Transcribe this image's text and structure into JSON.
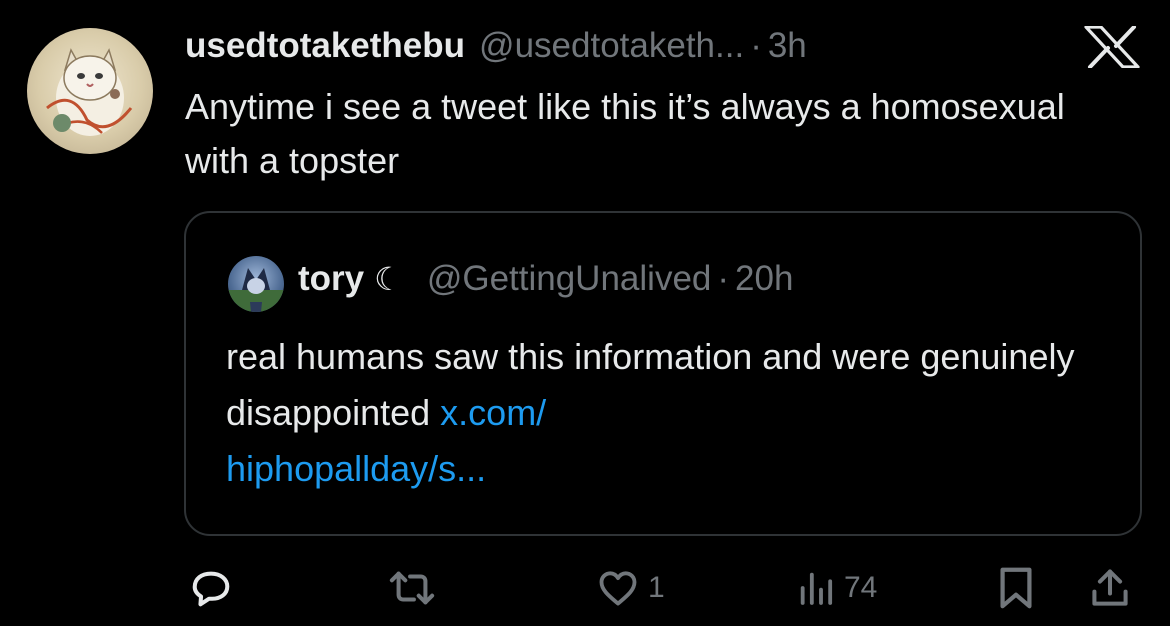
{
  "tweet": {
    "display_name": "usedtotakethebu",
    "handle": "@usedtotaketh...",
    "separator": "·",
    "time": "3h",
    "text": "Anytime i see a tweet like this it’s always a homosexual with a topster"
  },
  "quoted_tweet": {
    "display_name": "tory",
    "name_emoji": "☾",
    "handle": "@GettingUnalived",
    "separator": "·",
    "time": "20h",
    "text": "real humans saw this information and were genuinely disappointed ",
    "link_text": "x.com/\nhiphopallday/s..."
  },
  "actions": {
    "likes": "1",
    "views": "74"
  },
  "colors": {
    "background": "#000000",
    "text": "#e7e9ea",
    "secondary": "#71767b",
    "link": "#1d9bf0",
    "border": "#2f3336"
  },
  "icons": [
    "x-logo-icon",
    "reply-icon",
    "retweet-icon",
    "like-icon",
    "views-icon",
    "bookmark-icon",
    "share-icon"
  ]
}
